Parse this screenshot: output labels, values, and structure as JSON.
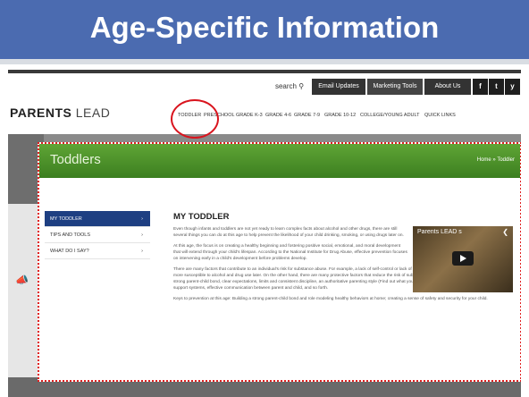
{
  "slide": {
    "title": "Age-Specific Information"
  },
  "utility_bar": {
    "search": "search",
    "email_updates": "Email Updates",
    "marketing_tools": "Marketing Tools",
    "about_us": "About Us",
    "social": [
      "f",
      "t",
      "y"
    ]
  },
  "logo": {
    "bold": "PARENTS",
    "light": "LEAD"
  },
  "nav": [
    "TODDLER",
    "PRESCHOOL",
    "GRADE K-3",
    "GRADE 4-6",
    "GRADE 7-9",
    "GRADE 10-12",
    "COLLEGE/YOUNG ADULT",
    "QUICK LINKS"
  ],
  "overlay": {
    "banner_title": "Toddlers",
    "breadcrumb": "Home » Toddler",
    "side_menu": [
      "MY TODDLER",
      "TIPS AND TOOLS",
      "WHAT DO I SAY?"
    ],
    "heading": "MY TODDLER",
    "paragraphs": [
      "Even though infants and toddlers are not yet ready to learn complex facts about alcohol and other drugs, there are still several things you can do at this age to help prevent the likelihood of your child drinking, smoking, or using drugs later on.",
      "At this age, the focus is on creating a healthy beginning and fostering positive social, emotional, and moral development that will extend through your child's lifespan. According to the National Institute for Drug Abuse, effective prevention focuses on intervening early in a child's development before problems develop.",
      "There are many factors that contribute to an individual's risk for substance abuse. For example, a lack of self-control or lack of attachment with at least one adult may make one more susceptible to alcohol and drug use later. On the other hand, there are many protective factors that reduce the risk of substance abuse in the later years. These include a strong parent-child bond, clear expectations, limits and consistent discipline, an authoritative parenting style (Find out what your parenting style is), parent involvement, trusting support systems, effective communication between parent and child, and so forth.",
      "Keys to prevention at this age: Building a strong parent-child bond and role modeling healthy behaviors at home; creating a sense of safety and security for your child."
    ],
    "video_title": "Parents LEAD s"
  }
}
